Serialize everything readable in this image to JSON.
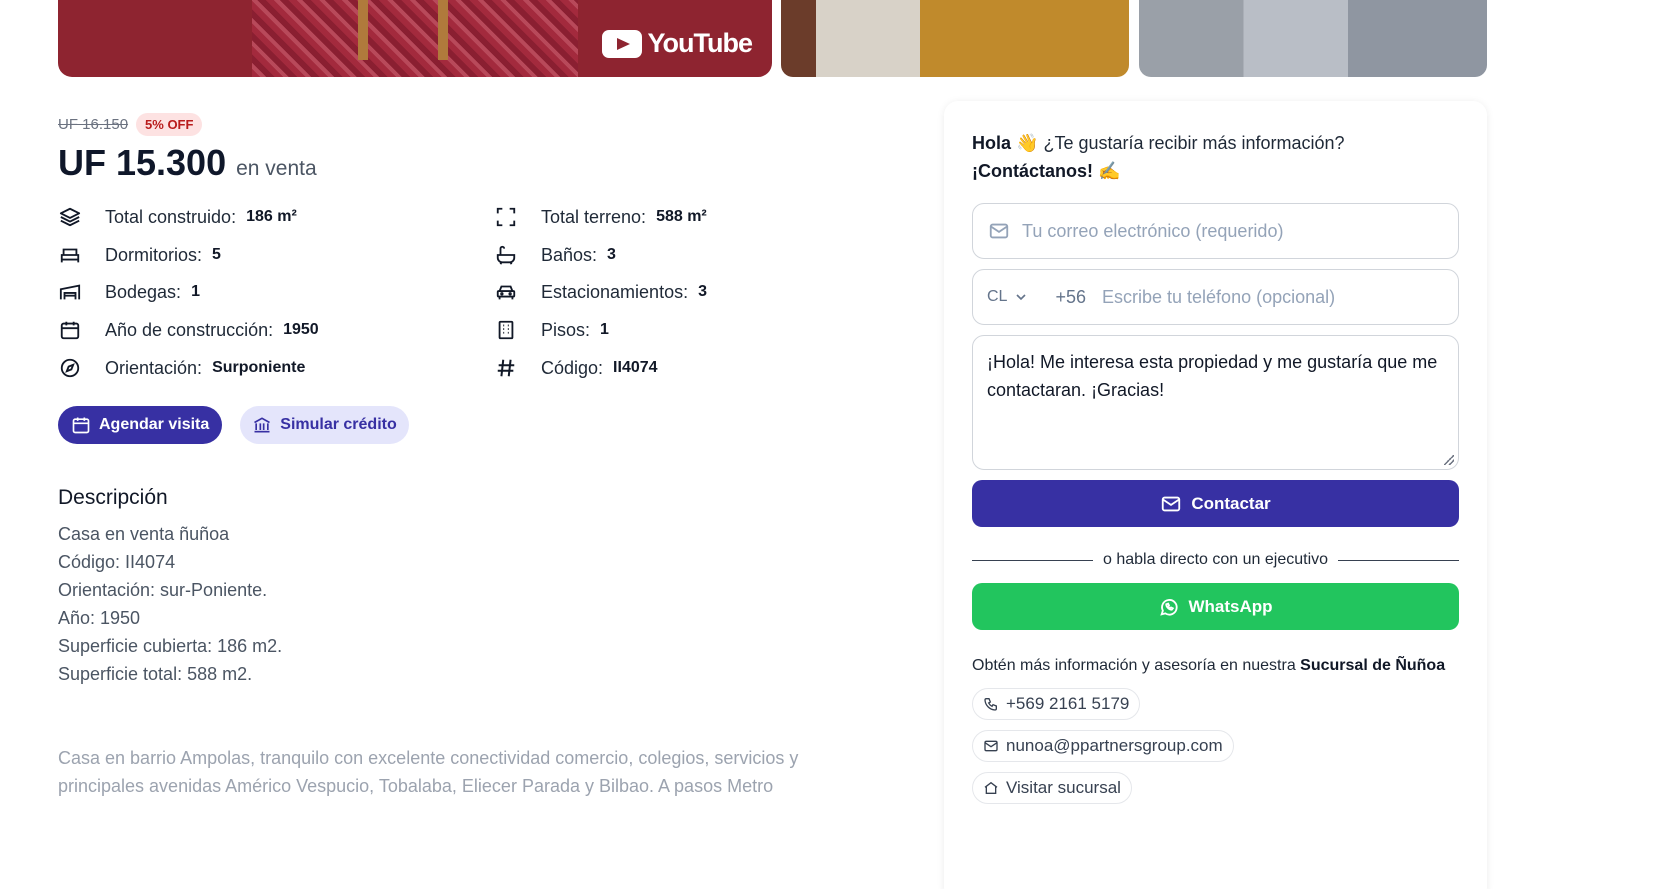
{
  "gallery": {
    "video_brand": "YouTube"
  },
  "pricing": {
    "old_price": "UF 16.150",
    "discount": "5% OFF",
    "price": "UF 15.300",
    "status": "en venta"
  },
  "features": [
    {
      "icon": "layers-icon",
      "label": "Total construido:",
      "value": "186 m²"
    },
    {
      "icon": "bed-icon",
      "label": "Dormitorios:",
      "value": "5"
    },
    {
      "icon": "warehouse-icon",
      "label": "Bodegas:",
      "value": "1"
    },
    {
      "icon": "calendar-icon",
      "label": "Año de construcción:",
      "value": "1950"
    },
    {
      "icon": "compass-icon",
      "label": "Orientación:",
      "value": "Surponiente"
    },
    {
      "icon": "expand-icon",
      "label": "Total terreno:",
      "value": "588 m²"
    },
    {
      "icon": "bath-icon",
      "label": "Baños:",
      "value": "3"
    },
    {
      "icon": "car-icon",
      "label": "Estacionamientos:",
      "value": "3"
    },
    {
      "icon": "building-icon",
      "label": "Pisos:",
      "value": "1"
    },
    {
      "icon": "hash-icon",
      "label": "Código:",
      "value": "II4074"
    }
  ],
  "actions": {
    "visit_label": "Agendar visita",
    "credit_label": "Simular crédito"
  },
  "description": {
    "title": "Descripción",
    "lines": [
      "Casa en venta ñuñoa",
      "Código: II4074",
      "Orientación: sur-Poniente.",
      "Año: 1950",
      "Superficie cubierta: 186 m2.",
      "Superficie total: 588 m2."
    ],
    "paragraph": "Casa en barrio Ampolas, tranquilo con excelente conectividad comercio, colegios, servicios y principales avenidas Américo Vespucio, Tobalaba, Eliecer Parada y Bilbao. A pasos Metro"
  },
  "contact": {
    "greeting_bold": "Hola",
    "greeting_wave": "👋",
    "greeting_text": " ¿Te gustaría recibir más información?",
    "cta_bold": "¡Contáctanos!",
    "cta_emoji": "✍️",
    "email_placeholder": "Tu correo electrónico (requerido)",
    "country_code": "CL",
    "phone_prefix": "+56",
    "phone_placeholder": "Escribe tu teléfono (opcional)",
    "message": "¡Hola! Me interesa esta propiedad y me gustaría que me contactaran. ¡Gracias!",
    "submit_label": "Contactar",
    "divider_text": "o habla directo con un ejecutivo",
    "whatsapp_label": "WhatsApp",
    "info_text": "Obtén más información y asesoría en nuestra ",
    "info_bold": "Sucursal de Ñuñoa",
    "phone": "+569 2161 5179",
    "email": "nunoa@ppartnersgroup.com",
    "visit_branch": "Visitar sucursal"
  },
  "colors": {
    "primary": "#3730a3",
    "whatsapp": "#22c55e",
    "discount": "#b91c1c"
  }
}
